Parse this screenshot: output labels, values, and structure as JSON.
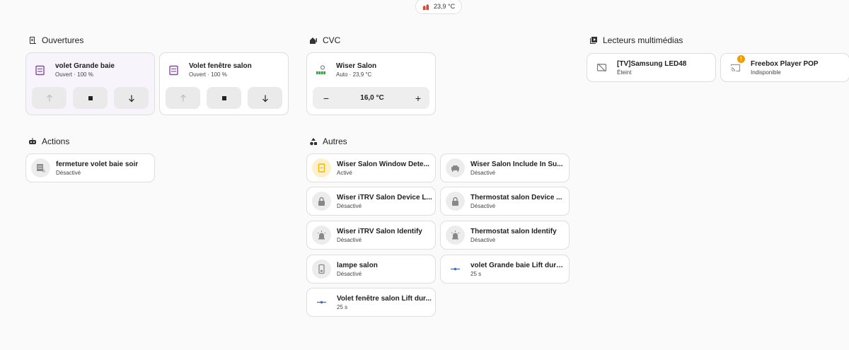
{
  "top_badge": {
    "icon": "heating-icon",
    "label": "23,9 °C",
    "icon_color": "#db4437"
  },
  "sections": {
    "ouvertures": {
      "title": "Ouvertures",
      "icon": "door-window-icon"
    },
    "cvc": {
      "title": "CVC",
      "icon": "home-thermometer-icon"
    },
    "lecteurs": {
      "title": "Lecteurs multimédias",
      "icon": "multimedia-icon"
    },
    "actions": {
      "title": "Actions",
      "icon": "robot-icon"
    },
    "autres": {
      "title": "Autres",
      "icon": "shapes-icon"
    }
  },
  "covers": [
    {
      "name": "volet Grande baie",
      "state": "Ouvert · 100 %",
      "icon": "window-shutter-open-icon",
      "color": "#8e44ad"
    },
    {
      "name": "Volet fenêtre salon",
      "state": "Ouvert · 100 %",
      "icon": "window-shutter-open-icon",
      "color": "#8e44ad"
    }
  ],
  "climate": {
    "name": "Wiser Salon",
    "state": "Auto · 23,9 °C",
    "target": "16,0 °C",
    "minus": "−",
    "plus": "+",
    "icon": "radiator-icon",
    "color": "#2e9e44"
  },
  "media": [
    {
      "name": "[TV]Samsung LED48",
      "state": "Éteint",
      "icon": "cast-off-icon"
    },
    {
      "name": "Freebox Player POP",
      "state": "Indisponible",
      "icon": "cast-icon",
      "badge": "!"
    }
  ],
  "actions": [
    {
      "name": "fermeture volet baie soir",
      "state": "Désactivé",
      "icon": "script-shutter-icon"
    }
  ],
  "autres": [
    {
      "name": "Wiser Salon Window Dete...",
      "state": "Activé",
      "icon": "window-icon",
      "active": true
    },
    {
      "name": "Wiser Salon Include In Su...",
      "state": "Désactivé",
      "icon": "sofa-icon"
    },
    {
      "name": "Wiser iTRV Salon Device L...",
      "state": "Désactivé",
      "icon": "lock-icon"
    },
    {
      "name": "Thermostat salon Device ...",
      "state": "Désactivé",
      "icon": "lock-icon"
    },
    {
      "name": "Wiser iTRV Salon Identify",
      "state": "Désactivé",
      "icon": "alarm-light-icon"
    },
    {
      "name": "Thermostat salon Identify",
      "state": "Désactivé",
      "icon": "alarm-light-icon"
    },
    {
      "name": "lampe salon",
      "state": "Désactivé",
      "icon": "switch-icon"
    },
    {
      "name": "volet Grande baie Lift dura...",
      "state": "25 s",
      "icon": "slider-icon"
    },
    {
      "name": "Volet fenêtre salon Lift dur...",
      "state": "25 s",
      "icon": "slider-icon"
    }
  ],
  "colors": {
    "accent_purple": "#8e44ad",
    "active_yellow": "#f2b705",
    "slider_blue": "#3f6fb5",
    "climate_green": "#2e9e44",
    "warning_orange": "#f29b05"
  }
}
